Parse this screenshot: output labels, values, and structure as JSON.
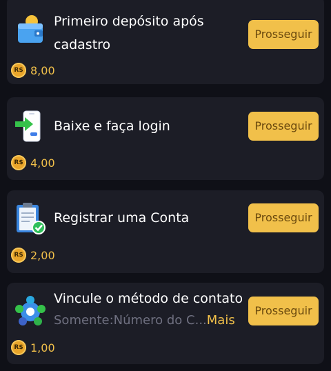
{
  "tasks": [
    {
      "title": "Primeiro depósito após cadastro",
      "subtitle": "",
      "more": "",
      "button": "Prosseguir",
      "currency": "R$",
      "reward": "8,00",
      "icon": "wallet-icon"
    },
    {
      "title": "Baixe e faça login",
      "subtitle": "",
      "more": "",
      "button": "Prosseguir",
      "currency": "R$",
      "reward": "4,00",
      "icon": "phone-download-icon"
    },
    {
      "title": "Registrar uma Conta",
      "subtitle": "",
      "more": "",
      "button": "Prosseguir",
      "currency": "R$",
      "reward": "2,00",
      "icon": "clipboard-check-icon"
    },
    {
      "title": "Vincule o método de contato",
      "subtitle": "Somente:Número do C...",
      "more": "Mais",
      "button": "Prosseguir",
      "currency": "R$",
      "reward": "1,00",
      "icon": "social-contacts-icon"
    }
  ],
  "colors": {
    "background": "#0f1017",
    "card": "#1c1d26",
    "accent": "#f1c04a",
    "button_text": "#6b4a0e"
  }
}
